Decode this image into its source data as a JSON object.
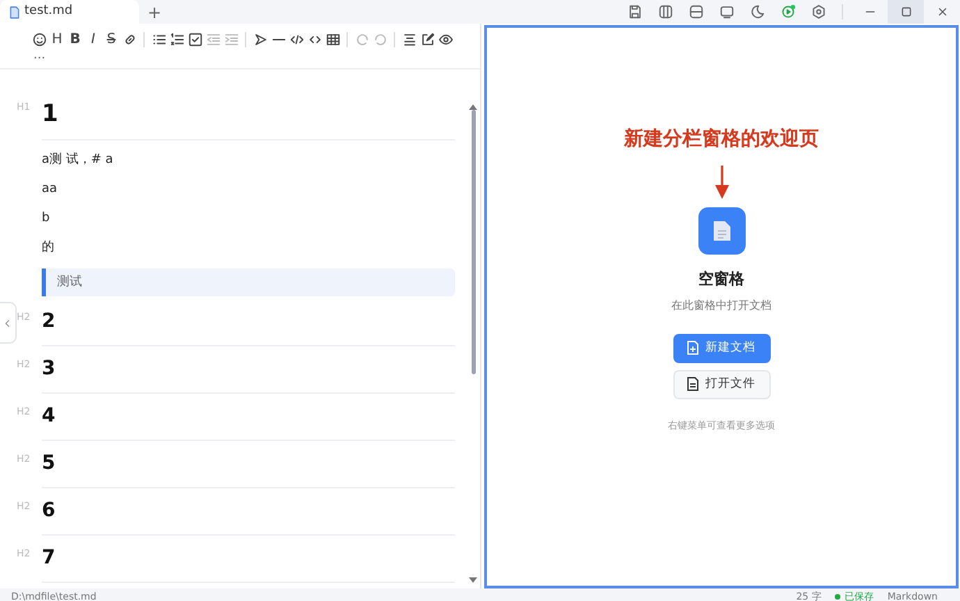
{
  "tabs": [
    {
      "label": "test.md",
      "selected": true
    }
  ],
  "new_tab": "+",
  "window_icons": [
    {
      "kind": "save"
    },
    {
      "kind": "split-columns"
    },
    {
      "kind": "split-rows"
    },
    {
      "kind": "screen"
    },
    {
      "kind": "moon"
    },
    {
      "kind": "status"
    },
    {
      "kind": "settings"
    }
  ],
  "window_controls": [
    {
      "kind": "minimize",
      "hovered": false
    },
    {
      "kind": "maximize",
      "hovered": true
    },
    {
      "kind": "close",
      "hovered": false
    }
  ],
  "toolbar": [
    {
      "kind": "emoji",
      "disabled": false
    },
    {
      "kind": "text",
      "label": "H",
      "disabled": false
    },
    {
      "kind": "text",
      "label": "B",
      "disabled": false
    },
    {
      "kind": "text",
      "label": "I",
      "disabled": false
    },
    {
      "kind": "text",
      "label": "S",
      "disabled": false
    },
    {
      "kind": "link",
      "disabled": false
    },
    {
      "kind": "sep"
    },
    {
      "kind": "list",
      "disabled": false
    },
    {
      "kind": "ordered-list",
      "disabled": false
    },
    {
      "kind": "checkbox",
      "disabled": false
    },
    {
      "kind": "outdent",
      "disabled": true
    },
    {
      "kind": "indent",
      "disabled": true
    },
    {
      "kind": "sep"
    },
    {
      "kind": "quote",
      "disabled": false
    },
    {
      "kind": "line",
      "disabled": false
    },
    {
      "kind": "code",
      "disabled": false
    },
    {
      "kind": "inline-code",
      "disabled": false
    },
    {
      "kind": "table",
      "disabled": false
    },
    {
      "kind": "sep"
    },
    {
      "kind": "undo",
      "disabled": true
    },
    {
      "kind": "redo",
      "disabled": true
    },
    {
      "kind": "sep"
    },
    {
      "kind": "align",
      "disabled": false
    },
    {
      "kind": "edit",
      "disabled": false
    },
    {
      "kind": "preview",
      "disabled": false
    }
  ],
  "toolbar_more": "...",
  "editor": [
    {
      "kind": "heading",
      "tag": "H1",
      "text": "1"
    },
    {
      "kind": "paragraph",
      "text": "a测 试，# a"
    },
    {
      "kind": "paragraph",
      "text": "aa"
    },
    {
      "kind": "paragraph",
      "text": "b"
    },
    {
      "kind": "paragraph",
      "text": "的"
    },
    {
      "kind": "quote",
      "text": "测试"
    },
    {
      "kind": "heading",
      "tag": "H2",
      "text": "2"
    },
    {
      "kind": "heading",
      "tag": "H2",
      "text": "3"
    },
    {
      "kind": "heading",
      "tag": "H2",
      "text": "4"
    },
    {
      "kind": "heading",
      "tag": "H2",
      "text": "5"
    },
    {
      "kind": "heading",
      "tag": "H2",
      "text": "6"
    },
    {
      "kind": "heading",
      "tag": "H2",
      "text": "7"
    }
  ],
  "welcome": {
    "annotation": "新建分栏窗格的欢迎页",
    "title": "空窗格",
    "subtitle": "在此窗格中打开文档",
    "buttons": [
      {
        "label": "新建文档",
        "kind": "primary"
      },
      {
        "label": "打开文件",
        "kind": "secondary"
      }
    ],
    "hint": "右键菜单可查看更多选项"
  },
  "status_bar": {
    "path": "D:\\mdfile\\test.md",
    "count": "25 字",
    "saved": "已保存",
    "mode": "Markdown"
  }
}
